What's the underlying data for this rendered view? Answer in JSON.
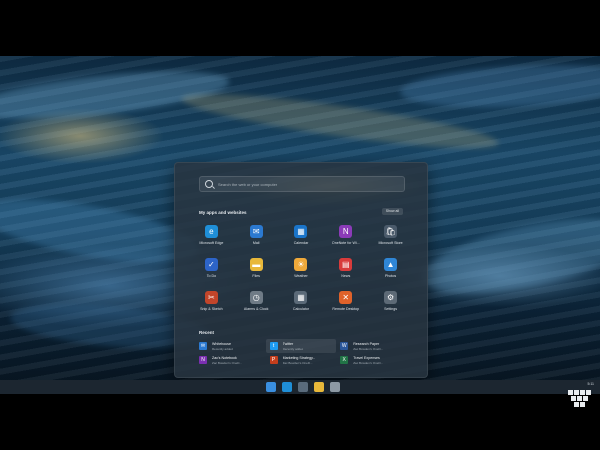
{
  "search": {
    "placeholder": "Search the web or your computer"
  },
  "apps_section": {
    "title": "My apps and websites",
    "show_all": "Show all"
  },
  "apps": [
    {
      "label": "Microsoft Edge",
      "icon": "edge-icon",
      "color": "#1f8fd8",
      "glyph": "e"
    },
    {
      "label": "Mail",
      "icon": "mail-icon",
      "color": "#2b79d0",
      "glyph": "✉"
    },
    {
      "label": "Calendar",
      "icon": "calendar-icon",
      "color": "#1a74c9",
      "glyph": "▦"
    },
    {
      "label": "OneNote for Wi...",
      "icon": "onenote-icon",
      "color": "#8b3bb8",
      "glyph": "N"
    },
    {
      "label": "Microsoft Store",
      "icon": "store-icon",
      "color": "#4a5a6a",
      "glyph": "🛍"
    },
    {
      "label": "To Do",
      "icon": "todo-icon",
      "color": "#2d64c8",
      "glyph": "✓"
    },
    {
      "label": "Files",
      "icon": "files-icon",
      "color": "#e8b83a",
      "glyph": "▬"
    },
    {
      "label": "Weather",
      "icon": "weather-icon",
      "color": "#f0a93a",
      "glyph": "☀"
    },
    {
      "label": "News",
      "icon": "news-icon",
      "color": "#d83b3b",
      "glyph": "▤"
    },
    {
      "label": "Photos",
      "icon": "photos-icon",
      "color": "#2f86d6",
      "glyph": "▲"
    },
    {
      "label": "Snip & Sketch",
      "icon": "snip-icon",
      "color": "#c2452a",
      "glyph": "✂"
    },
    {
      "label": "Alarms & Clock",
      "icon": "clock-icon",
      "color": "#6f7b86",
      "glyph": "◷"
    },
    {
      "label": "Calculator",
      "icon": "calculator-icon",
      "color": "#5b6a78",
      "glyph": "▦"
    },
    {
      "label": "Remote Desktop",
      "icon": "remote-desktop-icon",
      "color": "#e0622a",
      "glyph": "✕"
    },
    {
      "label": "Settings",
      "icon": "gear-icon",
      "color": "#5d6a76",
      "glyph": "⚙"
    }
  ],
  "recent_section": {
    "title": "Recent"
  },
  "recent": [
    {
      "name": "Whitehouse",
      "sub": "Recently added",
      "icon": "mail-icon",
      "color": "#2b79d0",
      "glyph": "✉",
      "highlight": false
    },
    {
      "name": "Twitter",
      "sub": "Recently added",
      "icon": "twitter-icon",
      "color": "#1d9bf0",
      "glyph": "t",
      "highlight": true
    },
    {
      "name": "Research Paper",
      "sub": "Zac Bowden's OneD...",
      "icon": "word-icon",
      "color": "#2b579a",
      "glyph": "W",
      "highlight": false
    },
    {
      "name": "Zac's Notebook",
      "sub": "Zac Bowden's OneD...",
      "icon": "onenote-icon",
      "color": "#7a2fb0",
      "glyph": "N",
      "highlight": false
    },
    {
      "name": "Marketing Strategy...",
      "sub": "Zac Bowden's OneD...",
      "icon": "powerpoint-icon",
      "color": "#c43e1c",
      "glyph": "P",
      "highlight": false
    },
    {
      "name": "Travel Expenses",
      "sub": "Zac Bowden's OneD...",
      "icon": "excel-icon",
      "color": "#217346",
      "glyph": "X",
      "highlight": false
    }
  ],
  "taskbar": {
    "icons": [
      {
        "icon": "start-icon",
        "color": "#3a8fe0"
      },
      {
        "icon": "edge-icon",
        "color": "#1f8fd8"
      },
      {
        "icon": "store-icon",
        "color": "#5a6b7c"
      },
      {
        "icon": "files-icon",
        "color": "#e8b83a"
      },
      {
        "icon": "chat-icon",
        "color": "#8d99a4"
      }
    ],
    "time": "5:11"
  }
}
